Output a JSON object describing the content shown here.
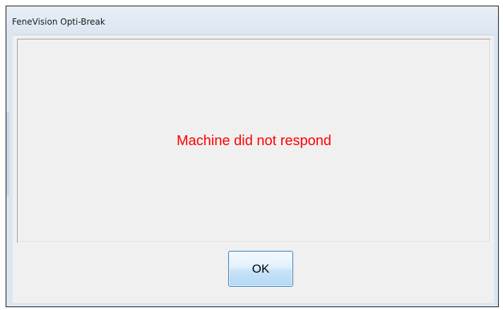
{
  "window": {
    "title": "FeneVision Opti-Break"
  },
  "message": {
    "text": "Machine did not respond",
    "color": "#ff0000"
  },
  "buttons": {
    "ok_label": "OK"
  }
}
